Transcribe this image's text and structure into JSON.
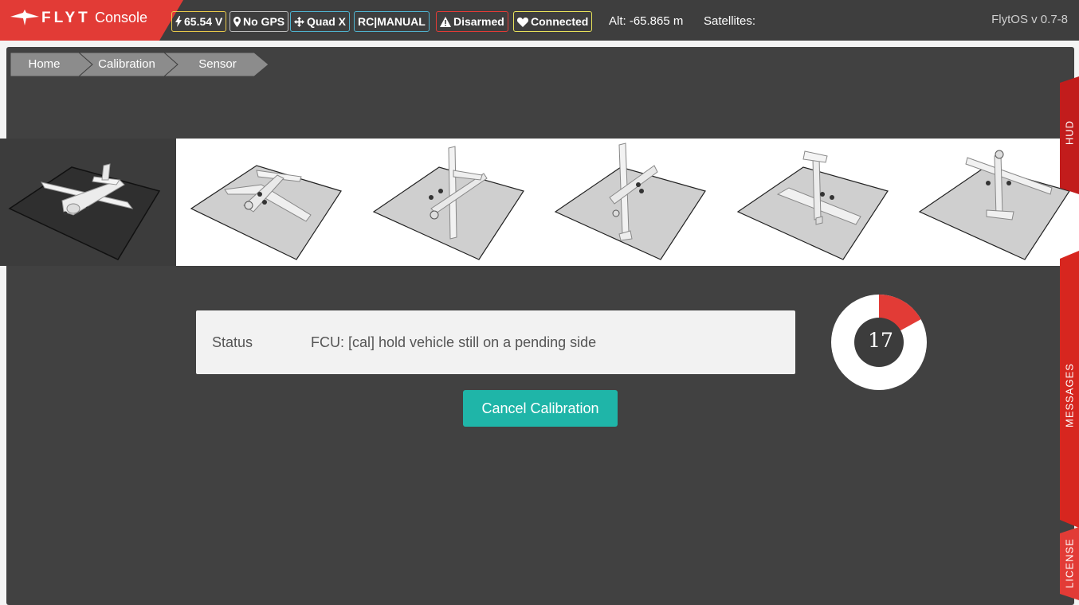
{
  "brand": {
    "word1": "FLYT",
    "word2": "Console"
  },
  "topbar": {
    "badges": [
      {
        "label": "65.54 V",
        "icon": "bolt-icon",
        "color": "#e8c94a"
      },
      {
        "label": "No GPS",
        "icon": "map-pin-icon",
        "color": "#bdbdbd"
      },
      {
        "label": "Quad X",
        "icon": "move-cross-icon",
        "color": "#4fb3cf"
      },
      {
        "label": "RC|MANUAL",
        "icon": "",
        "color": "#4fb3cf"
      },
      {
        "label": "Disarmed",
        "icon": "warning-icon",
        "color": "#e23b36"
      },
      {
        "label": "Connected",
        "icon": "heart-icon",
        "color": "#e8e25a"
      }
    ],
    "altitude": "Alt: -65.865 m",
    "satellites": "Satellites:",
    "version": "FlytOS v 0.7-8"
  },
  "breadcrumb": [
    "Home",
    "Calibration",
    "Sensor"
  ],
  "orientation_tiles": [
    {
      "name": "level",
      "active": true
    },
    {
      "name": "right-side",
      "active": false
    },
    {
      "name": "nose-down",
      "active": false
    },
    {
      "name": "tail-down",
      "active": false
    },
    {
      "name": "upside-down",
      "active": false
    },
    {
      "name": "left-side",
      "active": false
    }
  ],
  "status": {
    "label": "Status",
    "message": "FCU: [cal] hold vehicle still on a pending side"
  },
  "cancel_label": "Cancel Calibration",
  "progress": {
    "value": "17",
    "fraction": 0.17,
    "accent": "#e23b36"
  },
  "side_tabs": {
    "hud": "HUD",
    "messages": "MESSAGES",
    "license": "LICENSE"
  },
  "colors": {
    "accent": "#e23b36",
    "teal": "#1fb5a8",
    "panel": "#414141"
  }
}
